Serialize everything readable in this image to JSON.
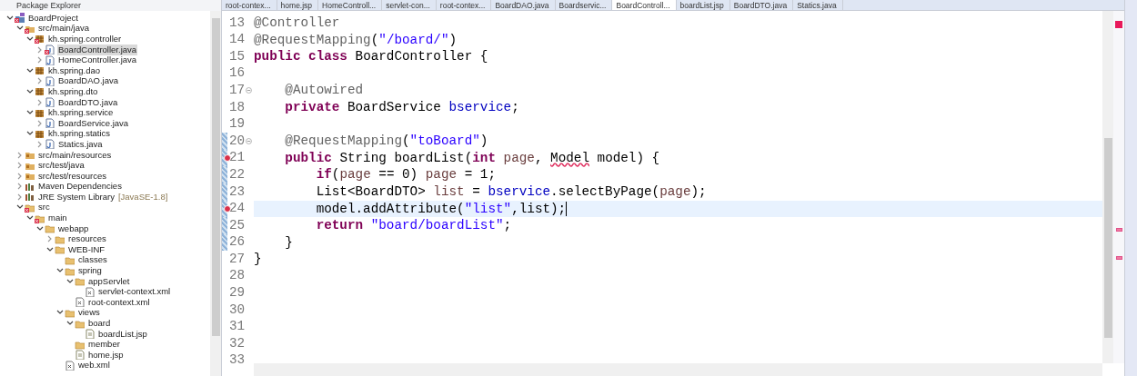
{
  "explorer": {
    "title": "Package Explorer",
    "tree": [
      {
        "label": "BoardProject",
        "kind": "project",
        "error": true,
        "expanded": true,
        "selected": false,
        "children": [
          {
            "label": "src/main/java",
            "kind": "srcfolder",
            "error": true,
            "expanded": true,
            "selected": false,
            "children": [
              {
                "label": "kh.spring.controller",
                "kind": "package",
                "error": true,
                "expanded": true,
                "selected": false,
                "children": [
                  {
                    "label": "BoardController.java",
                    "kind": "java",
                    "error": true,
                    "expanded": false,
                    "selected": true
                  },
                  {
                    "label": "HomeController.java",
                    "kind": "java",
                    "error": false,
                    "expanded": false,
                    "selected": false
                  }
                ]
              },
              {
                "label": "kh.spring.dao",
                "kind": "package",
                "error": false,
                "expanded": true,
                "selected": false,
                "children": [
                  {
                    "label": "BoardDAO.java",
                    "kind": "java",
                    "error": false,
                    "expanded": false,
                    "selected": false
                  }
                ]
              },
              {
                "label": "kh.spring.dto",
                "kind": "package",
                "error": false,
                "expanded": true,
                "selected": false,
                "children": [
                  {
                    "label": "BoardDTO.java",
                    "kind": "java",
                    "error": false,
                    "expanded": false,
                    "selected": false
                  }
                ]
              },
              {
                "label": "kh.spring.service",
                "kind": "package",
                "error": false,
                "expanded": true,
                "selected": false,
                "children": [
                  {
                    "label": "BoardService.java",
                    "kind": "java",
                    "error": false,
                    "expanded": false,
                    "selected": false
                  }
                ]
              },
              {
                "label": "kh.spring.statics",
                "kind": "package",
                "error": false,
                "expanded": true,
                "selected": false,
                "children": [
                  {
                    "label": "Statics.java",
                    "kind": "java",
                    "error": false,
                    "expanded": false,
                    "selected": false
                  }
                ]
              }
            ]
          },
          {
            "label": "src/main/resources",
            "kind": "srcfolder",
            "error": false,
            "expanded": false,
            "selected": false
          },
          {
            "label": "src/test/java",
            "kind": "srcfolder",
            "error": false,
            "expanded": false,
            "selected": false
          },
          {
            "label": "src/test/resources",
            "kind": "srcfolder",
            "error": false,
            "expanded": false,
            "selected": false
          },
          {
            "label": "Maven Dependencies",
            "kind": "library",
            "error": false,
            "expanded": false,
            "selected": false
          },
          {
            "label": "JRE System Library",
            "decoration": "[JavaSE-1.8]",
            "kind": "library",
            "error": false,
            "expanded": false,
            "selected": false
          },
          {
            "label": "src",
            "kind": "folder",
            "error": true,
            "expanded": true,
            "selected": false,
            "children": [
              {
                "label": "main",
                "kind": "folder",
                "error": true,
                "expanded": true,
                "selected": false,
                "children": [
                  {
                    "label": "webapp",
                    "kind": "folder",
                    "error": false,
                    "expanded": true,
                    "selected": false,
                    "children": [
                      {
                        "label": "resources",
                        "kind": "folder",
                        "error": false,
                        "expanded": false,
                        "selected": false
                      },
                      {
                        "label": "WEB-INF",
                        "kind": "folder",
                        "error": false,
                        "expanded": true,
                        "selected": false,
                        "children": [
                          {
                            "label": "classes",
                            "kind": "folder",
                            "error": false,
                            "selected": false
                          },
                          {
                            "label": "spring",
                            "kind": "folder",
                            "error": false,
                            "expanded": true,
                            "selected": false,
                            "children": [
                              {
                                "label": "appServlet",
                                "kind": "folder",
                                "error": false,
                                "expanded": true,
                                "selected": false,
                                "children": [
                                  {
                                    "label": "servlet-context.xml",
                                    "kind": "xml",
                                    "error": false,
                                    "selected": false
                                  }
                                ]
                              },
                              {
                                "label": "root-context.xml",
                                "kind": "xml",
                                "error": false,
                                "selected": false
                              }
                            ]
                          },
                          {
                            "label": "views",
                            "kind": "folder",
                            "error": false,
                            "expanded": true,
                            "selected": false,
                            "children": [
                              {
                                "label": "board",
                                "kind": "folder",
                                "error": false,
                                "expanded": true,
                                "selected": false,
                                "children": [
                                  {
                                    "label": "boardList.jsp",
                                    "kind": "jsp",
                                    "error": false,
                                    "selected": false
                                  }
                                ]
                              },
                              {
                                "label": "member",
                                "kind": "folder",
                                "error": false,
                                "selected": false
                              },
                              {
                                "label": "home.jsp",
                                "kind": "jsp",
                                "error": false,
                                "selected": false
                              }
                            ]
                          },
                          {
                            "label": "web.xml",
                            "kind": "xml",
                            "error": false,
                            "selected": false
                          }
                        ]
                      }
                    ]
                  }
                ]
              }
            ]
          }
        ]
      }
    ]
  },
  "editor_tabs": [
    {
      "label": "root-contex...",
      "selected": false
    },
    {
      "label": "home.jsp",
      "selected": false
    },
    {
      "label": "HomeControll...",
      "selected": false
    },
    {
      "label": "servlet-con...",
      "selected": false
    },
    {
      "label": "root-contex...",
      "selected": false
    },
    {
      "label": "BoardDAO.java",
      "selected": false
    },
    {
      "label": "Boardservic...",
      "selected": false
    },
    {
      "label": "BoardControll...",
      "selected": true
    },
    {
      "label": "boardList.jsp",
      "selected": false
    },
    {
      "label": "BoardDTO.java",
      "selected": false
    },
    {
      "label": "Statics.java",
      "selected": false
    }
  ],
  "code_lines": [
    {
      "number": "13",
      "fold": false,
      "error": false,
      "changed": false,
      "current": false,
      "tokens": [
        {
          "kind": "annotation",
          "text": "@Controller"
        }
      ]
    },
    {
      "number": "14",
      "fold": false,
      "error": false,
      "changed": false,
      "current": false,
      "tokens": [
        {
          "kind": "annotation",
          "text": "@RequestMapping"
        },
        {
          "kind": "plain",
          "text": "("
        },
        {
          "kind": "string",
          "text": "\"/board/\""
        },
        {
          "kind": "plain",
          "text": ")"
        }
      ]
    },
    {
      "number": "15",
      "fold": false,
      "error": false,
      "changed": false,
      "current": false,
      "tokens": [
        {
          "kind": "keyword",
          "text": "public class"
        },
        {
          "kind": "plain",
          "text": " BoardController {"
        }
      ]
    },
    {
      "number": "16",
      "fold": false,
      "error": false,
      "changed": false,
      "current": false
    },
    {
      "number": "17",
      "fold": true,
      "error": false,
      "changed": false,
      "current": false,
      "tokens": [
        {
          "kind": "annotation",
          "text": "    @Autowired"
        }
      ]
    },
    {
      "number": "18",
      "fold": false,
      "error": false,
      "changed": false,
      "current": false,
      "tokens": [
        {
          "kind": "keyword",
          "text": "    private"
        },
        {
          "kind": "plain",
          "text": " BoardService "
        },
        {
          "kind": "field",
          "text": "bservice"
        },
        {
          "kind": "plain",
          "text": ";"
        }
      ]
    },
    {
      "number": "19",
      "fold": false,
      "error": false,
      "changed": false,
      "current": false
    },
    {
      "number": "20",
      "fold": true,
      "error": false,
      "changed": true,
      "current": false,
      "tokens": [
        {
          "kind": "annotation",
          "text": "    @RequestMapping"
        },
        {
          "kind": "plain",
          "text": "("
        },
        {
          "kind": "string",
          "text": "\"toBoard\""
        },
        {
          "kind": "plain",
          "text": ")"
        }
      ]
    },
    {
      "number": "21",
      "fold": false,
      "error": true,
      "changed": true,
      "current": false,
      "tokens": [
        {
          "kind": "keyword",
          "text": "    public"
        },
        {
          "kind": "plain",
          "text": " String boardList("
        },
        {
          "kind": "keyword",
          "text": "int "
        },
        {
          "kind": "local",
          "text": "page"
        },
        {
          "kind": "plain",
          "text": ", "
        },
        {
          "kind": "squiggle",
          "text": "Model"
        },
        {
          "kind": "plain",
          "text": " model) {"
        }
      ]
    },
    {
      "number": "22",
      "fold": false,
      "error": false,
      "changed": true,
      "current": false,
      "tokens": [
        {
          "kind": "keyword",
          "text": "        if"
        },
        {
          "kind": "plain",
          "text": "("
        },
        {
          "kind": "local",
          "text": "page"
        },
        {
          "kind": "plain",
          "text": " == 0) "
        },
        {
          "kind": "local",
          "text": "page"
        },
        {
          "kind": "plain",
          "text": " = 1;"
        }
      ]
    },
    {
      "number": "23",
      "fold": false,
      "error": false,
      "changed": true,
      "current": false,
      "tokens": [
        {
          "kind": "plain",
          "text": "        List<BoardDTO> "
        },
        {
          "kind": "local",
          "text": "list"
        },
        {
          "kind": "plain",
          "text": " = "
        },
        {
          "kind": "field",
          "text": "bservice"
        },
        {
          "kind": "plain",
          "text": ".selectByPage("
        },
        {
          "kind": "local",
          "text": "page"
        },
        {
          "kind": "plain",
          "text": ");"
        }
      ]
    },
    {
      "number": "24",
      "fold": false,
      "error": true,
      "changed": true,
      "current": true,
      "tokens": [
        {
          "kind": "plain",
          "text": "        model.addAttribute("
        },
        {
          "kind": "string",
          "text": "\"list\""
        },
        {
          "kind": "plain",
          "text": ",list);"
        }
      ]
    },
    {
      "number": "25",
      "fold": false,
      "error": false,
      "changed": true,
      "current": false,
      "tokens": [
        {
          "kind": "keyword",
          "text": "        return "
        },
        {
          "kind": "string",
          "text": "\"board/boardList\""
        },
        {
          "kind": "plain",
          "text": ";"
        }
      ]
    },
    {
      "number": "26",
      "fold": false,
      "error": false,
      "changed": true,
      "current": false,
      "tokens": [
        {
          "kind": "plain",
          "text": "    }"
        }
      ]
    },
    {
      "number": "27",
      "fold": false,
      "error": false,
      "changed": false,
      "current": false,
      "tokens": [
        {
          "kind": "plain",
          "text": "}"
        }
      ]
    },
    {
      "number": "28",
      "fold": false,
      "error": false,
      "changed": false,
      "current": false
    },
    {
      "number": "29",
      "fold": false,
      "error": false,
      "changed": false,
      "current": false
    },
    {
      "number": "30",
      "fold": false,
      "error": false,
      "changed": false,
      "current": false
    },
    {
      "number": "31",
      "fold": false,
      "error": false,
      "changed": false,
      "current": false
    },
    {
      "number": "32",
      "fold": false,
      "error": false,
      "changed": false,
      "current": false
    },
    {
      "number": "33",
      "fold": false,
      "error": false,
      "changed": false,
      "current": false
    }
  ]
}
